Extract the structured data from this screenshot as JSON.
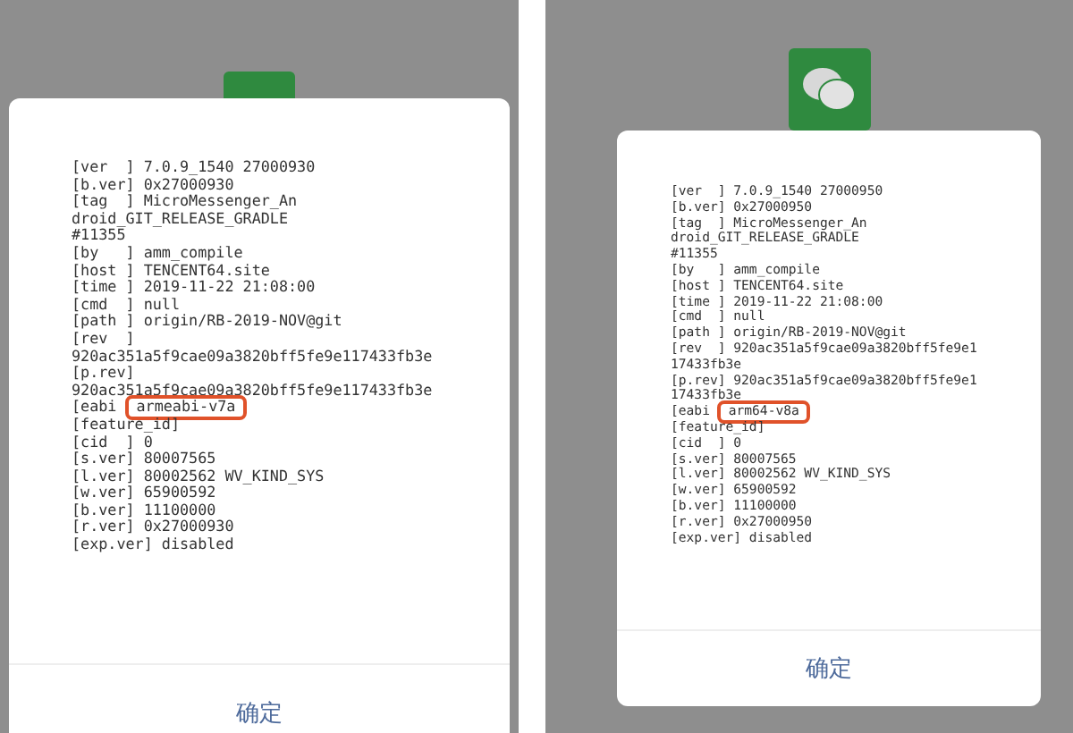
{
  "panels": [
    {
      "lines": [
        {
          "text": "[ver  ] 7.0.9_1540 27000930"
        },
        {
          "text": "[b.ver] 0x27000930"
        },
        {
          "text": "[tag  ] MicroMessenger_An"
        },
        {
          "text": "droid_GIT_RELEASE_GRADLE"
        },
        {
          "text": "#11355"
        },
        {
          "text": "[by   ] amm_compile"
        },
        {
          "text": "[host ] TENCENT64.site"
        },
        {
          "text": "[time ] 2019-11-22 21:08:00"
        },
        {
          "text": "[cmd  ] null"
        },
        {
          "text": "[path ] origin/RB-2019-NOV@git"
        },
        {
          "text": "[rev  ]"
        },
        {
          "text": "920ac351a5f9cae09a3820bff5fe9e117433fb3e"
        },
        {
          "text": "[p.rev]"
        },
        {
          "text": "920ac351a5f9cae09a3820bff5fe9e117433fb3e"
        },
        {
          "text": "[eabi ",
          "value": "armeabi-v7a",
          "highlighted": true
        },
        {
          "text": "[feature_id]"
        },
        {
          "text": "[cid  ] 0"
        },
        {
          "text": "[s.ver] 80007565"
        },
        {
          "text": "[l.ver] 80002562 WV_KIND_SYS"
        },
        {
          "text": "[w.ver] 65900592"
        },
        {
          "text": "[b.ver] 11100000"
        },
        {
          "text": "[r.ver] 0x27000930"
        },
        {
          "text": "[exp.ver] disabled"
        }
      ],
      "button": "确定"
    },
    {
      "lines": [
        {
          "text": "[ver  ] 7.0.9_1540 27000950"
        },
        {
          "text": "[b.ver] 0x27000950"
        },
        {
          "text": "[tag  ] MicroMessenger_An"
        },
        {
          "text": "droid_GIT_RELEASE_GRADLE"
        },
        {
          "text": "#11355"
        },
        {
          "text": "[by   ] amm_compile"
        },
        {
          "text": "[host ] TENCENT64.site"
        },
        {
          "text": "[time ] 2019-11-22 21:08:00"
        },
        {
          "text": "[cmd  ] null"
        },
        {
          "text": "[path ] origin/RB-2019-NOV@git"
        },
        {
          "text": "[rev  ] 920ac351a5f9cae09a3820bff5fe9e1"
        },
        {
          "text": "17433fb3e"
        },
        {
          "text": "[p.rev] 920ac351a5f9cae09a3820bff5fe9e1"
        },
        {
          "text": "17433fb3e"
        },
        {
          "text": "[eabi ",
          "value": "arm64-v8a",
          "highlighted": true
        },
        {
          "text": "[feature_id]"
        },
        {
          "text": "[cid  ] 0"
        },
        {
          "text": "[s.ver] 80007565"
        },
        {
          "text": "[l.ver] 80002562 WV_KIND_SYS"
        },
        {
          "text": "[w.ver] 65900592"
        },
        {
          "text": "[b.ver] 11100000"
        },
        {
          "text": "[r.ver] 0x27000950"
        },
        {
          "text": "[exp.ver] disabled"
        }
      ],
      "button": "确定"
    }
  ]
}
